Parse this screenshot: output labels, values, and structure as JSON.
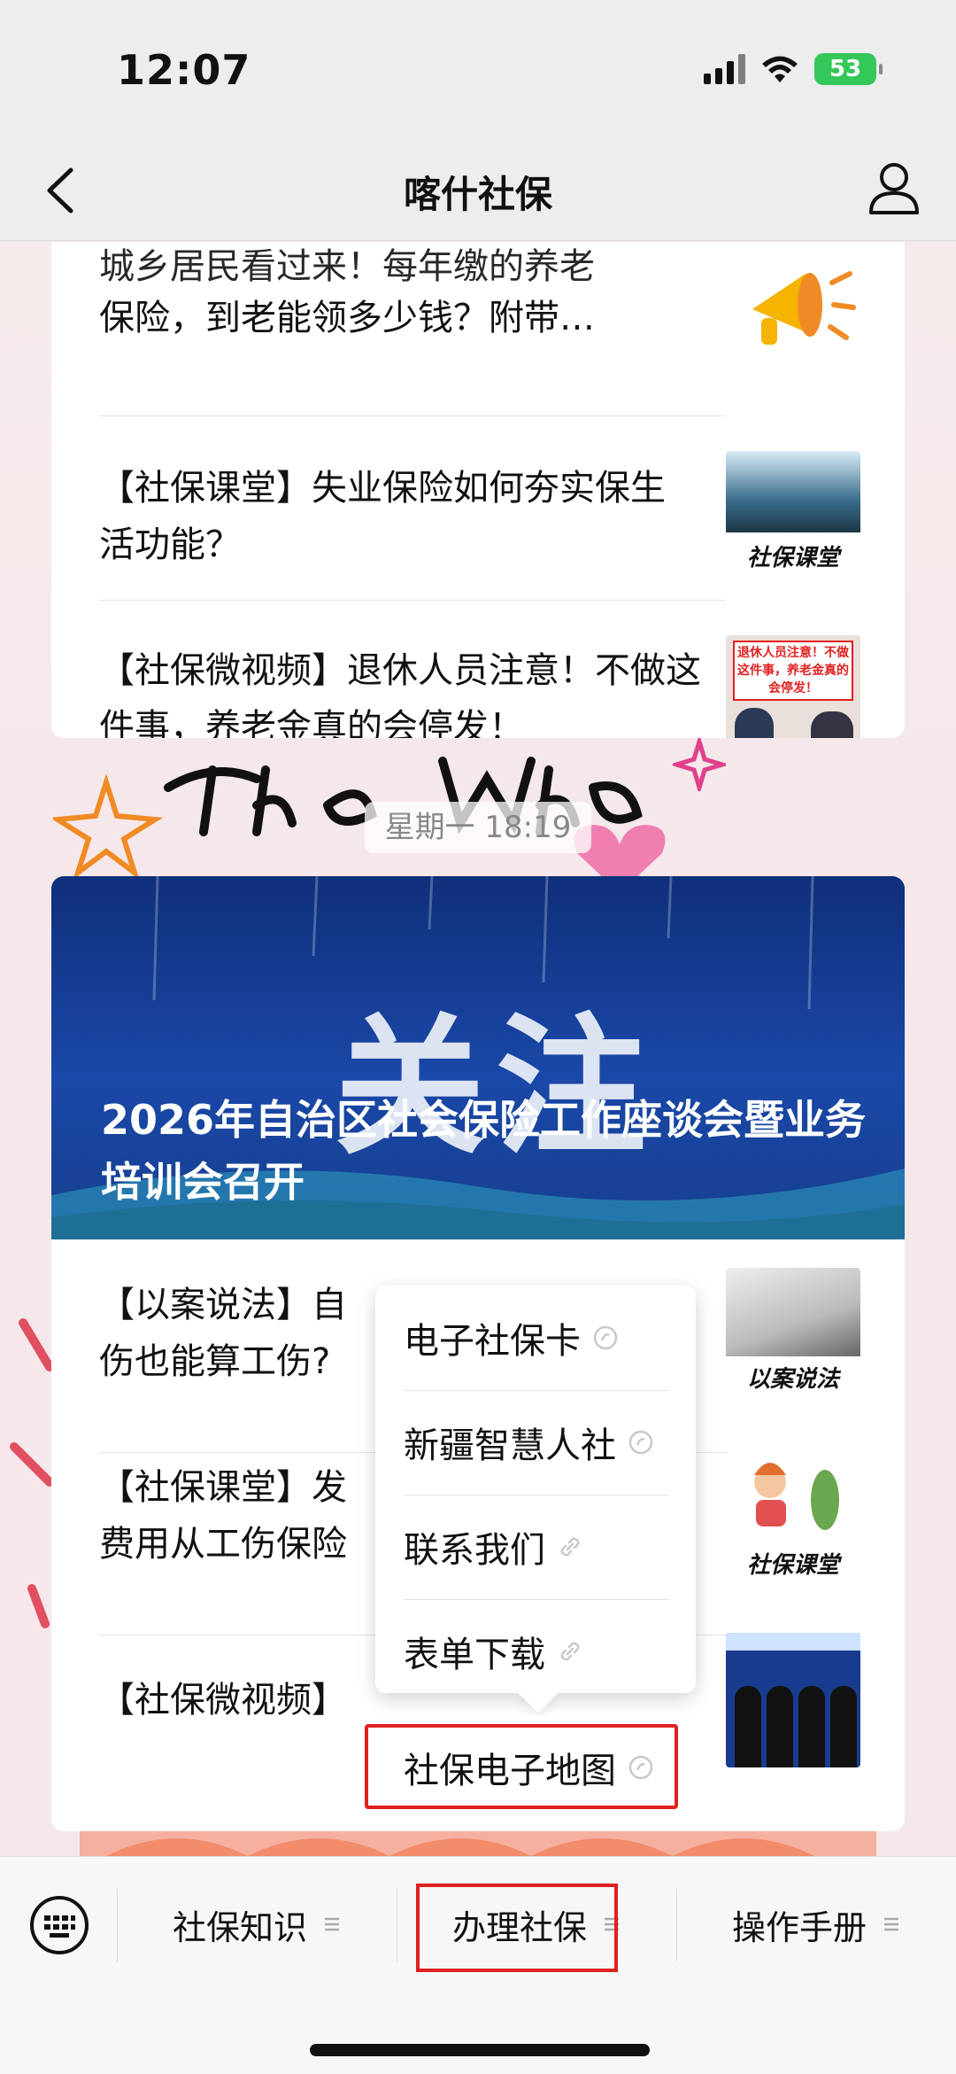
{
  "status": {
    "time": "12:07",
    "battery": "53"
  },
  "nav": {
    "title": "喀什社保"
  },
  "articles_top": [
    {
      "title": "保险，到老能领多少钱？附带…",
      "thumb_label": ""
    },
    {
      "title": "【社保课堂】失业保险如何夯实保生活功能？",
      "thumb_label": "社保课堂"
    },
    {
      "title": "【社保微视频】退休人员注意！不做这件事，养老金真的会停发！",
      "thumb_label": "退休人员注意！不做这件事，养老金真的会停发！"
    }
  ],
  "time_badge": "星期一 18:19",
  "banner": {
    "watermark": "关注",
    "headline": "2026年自治区社会保险工作座谈会暨业务培训会召开"
  },
  "articles_bottom": [
    {
      "title_start": "【以案说法】自",
      "title_end": "伤也能算工伤?",
      "thumb_label": "以案说法"
    },
    {
      "title_start": "【社保课堂】发",
      "title_end": "费用从工伤保险",
      "thumb_label": "社保课堂"
    },
    {
      "title_start": "【社保微视频】",
      "thumb_label": ""
    }
  ],
  "popup_menu": [
    {
      "label": "电子社保卡"
    },
    {
      "label": "新疆智慧人社"
    },
    {
      "label": "联系我们"
    },
    {
      "label": "表单下载"
    },
    {
      "label": "社保电子地图"
    }
  ],
  "bottom_menu": [
    {
      "label": "社保知识"
    },
    {
      "label": "办理社保"
    },
    {
      "label": "操作手册"
    }
  ],
  "colors": {
    "highlight": "#e02020",
    "banner_blue": "#1a48a8",
    "battery_green": "#34c759"
  }
}
